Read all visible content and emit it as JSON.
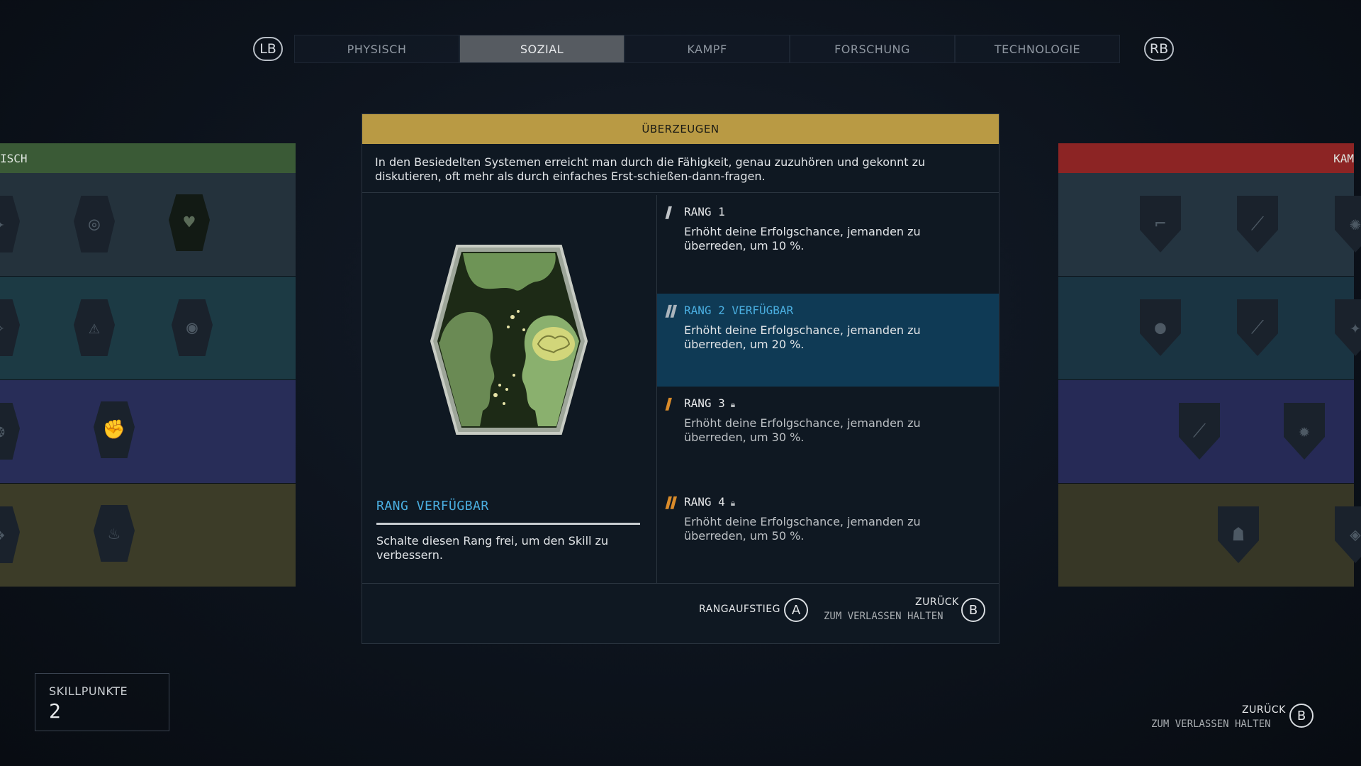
{
  "tabs": {
    "lb": "LB",
    "rb": "RB",
    "items": [
      {
        "label": "PHYSISCH",
        "active": false
      },
      {
        "label": "SOZIAL",
        "active": true
      },
      {
        "label": "KAMPF",
        "active": false
      },
      {
        "label": "FORSCHUNG",
        "active": false
      },
      {
        "label": "TECHNOLOGIE",
        "active": false
      }
    ]
  },
  "side_left": {
    "header": "ISCH",
    "color": "#3a5a36"
  },
  "side_right": {
    "header": "KAM",
    "color": "#8c2424"
  },
  "dialog": {
    "title": "ÜBERZEUGEN",
    "description": "In den Besiedelten Systemen erreicht man durch die Fähigkeit, genau zuzuhören und gekonnt zu diskutieren, oft mehr als durch einfaches Erst-schießen-dann-fragen.",
    "available_title": "RANG VERFÜGBAR",
    "available_text": "Schalte diesen Rang frei, um den Skill zu verbessern.",
    "ranks": [
      {
        "name": "RANG 1",
        "text": "Erhöht deine Erfolgschance, jemanden zu überreden, um 10 %.",
        "state": "unlocked",
        "bars": 1
      },
      {
        "name": "RANG 2 VERFÜGBAR",
        "text": "Erhöht deine Erfolgschance, jemanden zu überreden, um 20 %.",
        "state": "available",
        "bars": 2
      },
      {
        "name": "RANG 3",
        "text": "Erhöht deine Erfolgschance, jemanden zu überreden, um 30 %.",
        "state": "locked",
        "bars": 1
      },
      {
        "name": "RANG 4",
        "text": "Erhöht deine Erfolgschance, jemanden zu überreden, um 50 %.",
        "state": "locked",
        "bars": 2
      }
    ],
    "footer": {
      "rankup_label": "RANGAUFSTIEG",
      "rankup_button": "A",
      "back_label": "ZURÜCK",
      "back_sub": "ZUM VERLASSEN HALTEN",
      "back_button": "B"
    }
  },
  "skillpoints": {
    "label": "SKILLPUNKTE",
    "value": "2"
  },
  "bottom_right": {
    "label": "ZURÜCK",
    "sub": "ZUM VERLASSEN HALTEN",
    "button": "B"
  },
  "colors": {
    "accent_gold": "#b99a44",
    "accent_blue": "#4aaee0",
    "locked_orange": "#d98b2a"
  }
}
